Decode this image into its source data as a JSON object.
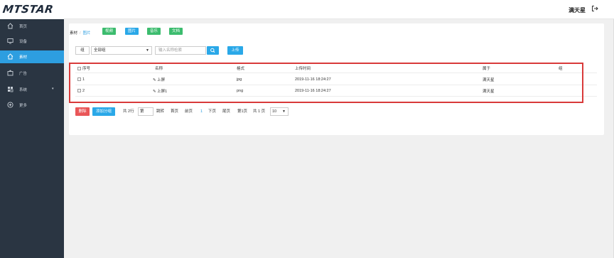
{
  "header": {
    "logo": "MTSTAR",
    "user": "满天星"
  },
  "sidebar": {
    "items": [
      {
        "label": "首页",
        "icon": "home-icon"
      },
      {
        "label": "设备",
        "icon": "device-icon"
      },
      {
        "label": "素材",
        "icon": "material-icon",
        "active": true
      },
      {
        "label": "广告",
        "icon": "ad-icon"
      },
      {
        "label": "系统",
        "icon": "grid-icon",
        "caret": "▾"
      },
      {
        "label": "更多",
        "icon": "plus-circle-icon"
      }
    ]
  },
  "breadcrumb": {
    "root": "素材",
    "sep": "/",
    "current": "图片"
  },
  "type_tabs": [
    "视频",
    "图片",
    "音乐",
    "文档"
  ],
  "toolbar": {
    "group_label": "组",
    "select_value": "全部组",
    "search_placeholder": "输入名称检索",
    "upload_label": "上传"
  },
  "table": {
    "headers": [
      "序号",
      "名称",
      "格式",
      "上传时间",
      "属于",
      "组"
    ],
    "rows": [
      {
        "idx": "1",
        "name": "上屏",
        "format": "jpg",
        "time": "2019-11-16 18:24:27",
        "owner": "满天星",
        "group": ""
      },
      {
        "idx": "2",
        "name": "上屏1",
        "format": "png",
        "time": "2019-11-16 18:24:27",
        "owner": "满天星",
        "group": ""
      }
    ]
  },
  "pagination": {
    "delete_label": "删除",
    "add_group_label": "添加分组",
    "total": "共 2行",
    "page_input": "第",
    "jump": "跳转",
    "first": "首页",
    "prev": "前页",
    "current": "1",
    "next": "下页",
    "last": "尾页",
    "page_info": "第1页",
    "total_pages": "共 1 页",
    "page_size": "10"
  },
  "colors": {
    "sidebar_bg": "#2a3542",
    "accent": "#2d9ee0",
    "green": "#3cbc6e",
    "danger": "#e95658",
    "highlight": "#d93a3a"
  }
}
